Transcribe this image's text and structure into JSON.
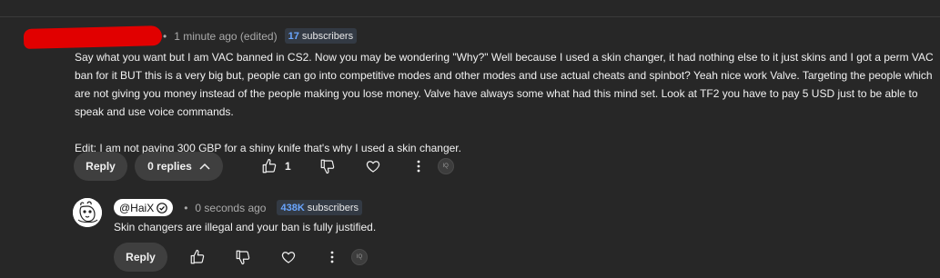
{
  "comment": {
    "time": "1 minute ago (edited)",
    "subscriber_count": "17",
    "subscriber_label": "subscribers",
    "paragraph1": "Say what you want but I am VAC banned in CS2. Now you may be wondering \"Why?\" Well because I used a skin changer, it had nothing else to it just skins and I got a perm VAC ban for it BUT this is a very big but, people can go into competitive modes and other modes and use actual cheats and spinbot? Yeah nice work Valve. Targeting the people which are not giving you money instead of the people making you lose money. Valve have always some what had this mind set. Look at TF2 you have to pay 5 USD just to be able to speak and use voice commands.",
    "paragraph2": "Edit: I am not paying 300 GBP for a shiny knife that's why I used a skin changer.",
    "reply_label": "Reply",
    "replies_label": "0 replies",
    "like_count": "1"
  },
  "reply": {
    "handle": "@HaiX",
    "time": "0 seconds ago",
    "subscriber_count": "438K",
    "subscriber_label": "subscribers",
    "text": "Skin changers are illegal and your ban is fully justified.",
    "reply_label": "Reply"
  },
  "colors": {
    "background": "#272727",
    "badge_number": "#6aa6ff",
    "redaction": "#e10000"
  },
  "icons": [
    "thumbs-up-icon",
    "thumbs-down-icon",
    "heart-icon",
    "more-vert-icon",
    "chevron-up-icon",
    "verified-icon"
  ]
}
